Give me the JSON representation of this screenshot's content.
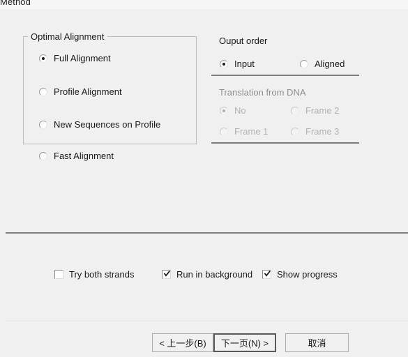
{
  "window": {
    "title": "Method",
    "background_color": "#f0f0f0",
    "header_band_color": "#f6f6f6"
  },
  "optimal_alignment_group": {
    "legend": "Optimal Alignment",
    "options": [
      {
        "label": "Full Alignment",
        "checked": true,
        "disabled": false
      },
      {
        "label": "Profile Alignment",
        "checked": false,
        "disabled": false
      },
      {
        "label": "New Sequences on Profile",
        "checked": false,
        "disabled": false
      }
    ]
  },
  "fast_alignment": {
    "label": "Fast Alignment",
    "checked": false,
    "disabled": false
  },
  "output_order": {
    "heading": "Ouput order",
    "options": [
      {
        "label": "Input",
        "checked": true,
        "disabled": false
      },
      {
        "label": "Aligned",
        "checked": false,
        "disabled": false
      }
    ]
  },
  "translation_from_dna": {
    "heading": "Translation from DNA",
    "disabled": true,
    "options": [
      {
        "label": "No",
        "checked": true,
        "disabled": true
      },
      {
        "label": "Frame 2",
        "checked": false,
        "disabled": true
      },
      {
        "label": "Frame 1",
        "checked": false,
        "disabled": true
      },
      {
        "label": "Frame 3",
        "checked": false,
        "disabled": true
      }
    ]
  },
  "checkboxes": [
    {
      "label": "Try both strands",
      "checked": false
    },
    {
      "label": "Run in background",
      "checked": true
    },
    {
      "label": "Show progress",
      "checked": true
    }
  ],
  "buttons": {
    "back": "< 上一步(B)",
    "next": "下一页(N) >",
    "cancel": "取消",
    "default_button": "next"
  }
}
